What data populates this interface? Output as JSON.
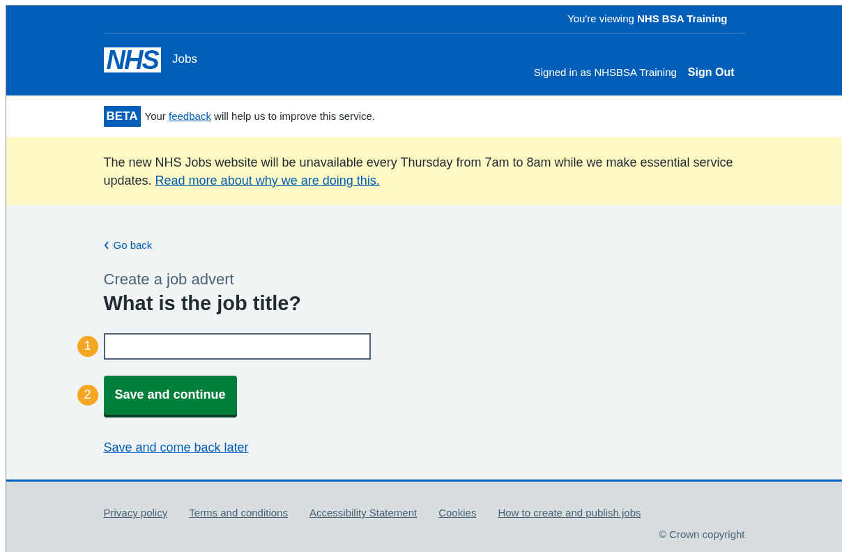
{
  "header": {
    "viewing_prefix": "You're viewing",
    "viewing_org": "NHS BSA Training",
    "logo": "NHS",
    "service": "Jobs",
    "signed_in": "Signed in as NHSBSA Training",
    "sign_out": "Sign Out"
  },
  "phase_banner": {
    "tag": "BETA",
    "text_before": "Your",
    "link": "feedback",
    "text_after": "will help us to improve this service."
  },
  "notice": {
    "text": "The new NHS Jobs website will be unavailable every Thursday from 7am to 8am while we make essential service updates.",
    "link": "Read more about why we are doing this."
  },
  "back_link": "Go back",
  "caption": "Create a job advert",
  "heading": "What is the job title?",
  "input": {
    "callout": "1"
  },
  "primary_button": {
    "label": "Save and continue",
    "callout": "2"
  },
  "secondary_link": "Save and come back later",
  "footer": {
    "links": [
      "Privacy policy",
      "Terms and conditions",
      "Accessibility Statement",
      "Cookies",
      "How to create and publish jobs"
    ],
    "copyright": "© Crown copyright"
  }
}
